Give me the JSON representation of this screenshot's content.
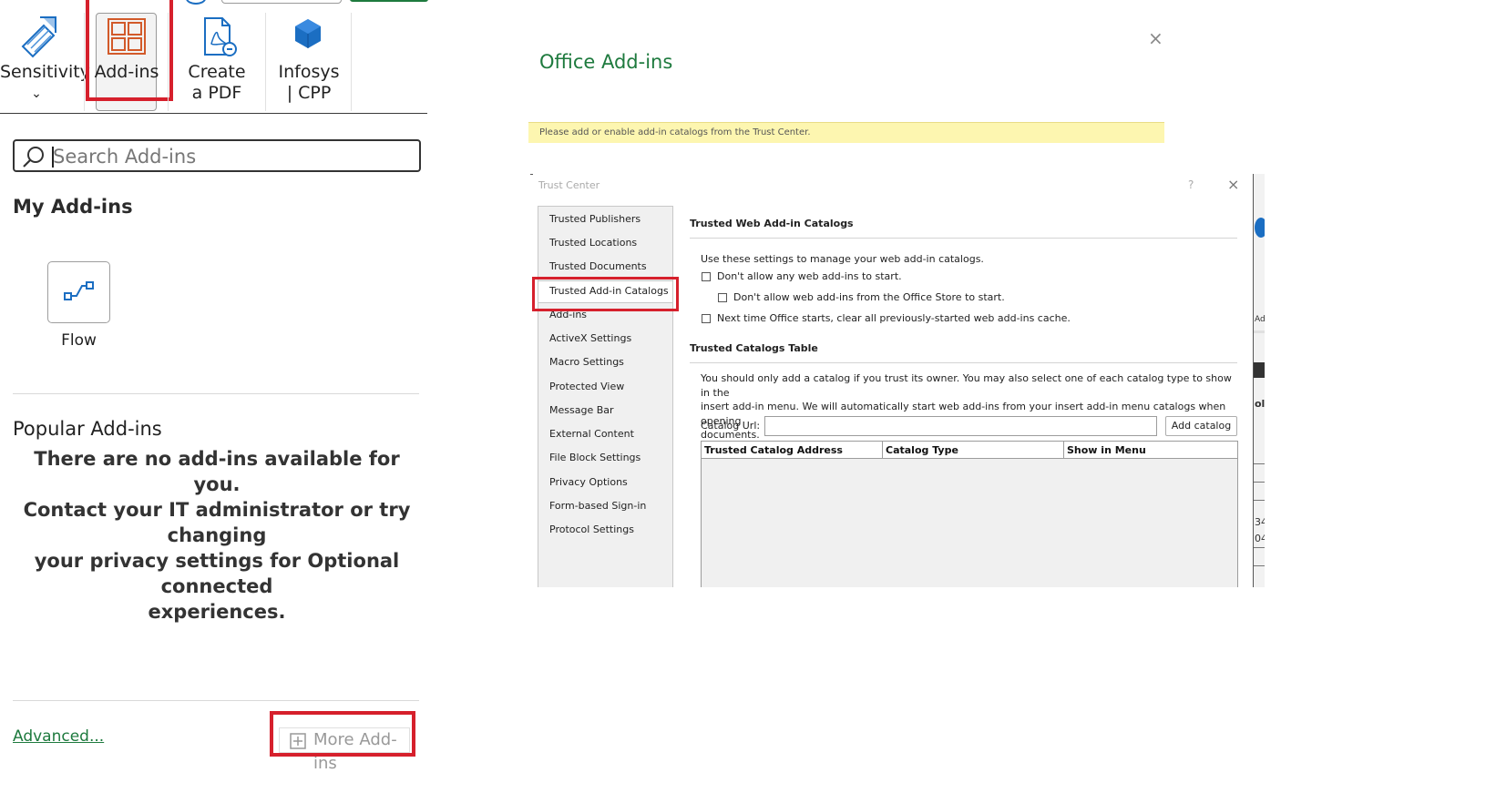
{
  "ribbon": {
    "sensitivity": {
      "label": "Sensitivity",
      "chevron": "⌄",
      "icon": "sensitivity-icon"
    },
    "addins": {
      "label": "Add-ins",
      "icon": "addins-grid-icon"
    },
    "create_pdf": {
      "line1": "Create",
      "line2": "a PDF",
      "icon": "pdf-icon"
    },
    "infosys": {
      "line1": "Infosys",
      "line2": "| CPP",
      "icon": "cube-icon"
    }
  },
  "search": {
    "placeholder": "Search Add-ins"
  },
  "my_addins": {
    "heading": "My Add-ins",
    "items": [
      {
        "label": "Flow",
        "icon": "flow-icon"
      }
    ]
  },
  "popular": {
    "heading": "Popular Add-ins",
    "message_lines": [
      "There are no add-ins available for you.",
      "Contact your IT administrator or try changing",
      "your privacy settings for Optional connected",
      "experiences."
    ]
  },
  "footer": {
    "advanced_link": "Advanced...",
    "more_addins": "More Add-ins"
  },
  "office_dialog": {
    "title": "Office Add-ins",
    "close": "×",
    "warning": "Please add or enable add-in catalogs from the Trust Center."
  },
  "trust_center": {
    "title": "Trust Center",
    "help": "?",
    "close": "×",
    "nav": [
      "Trusted Publishers",
      "Trusted Locations",
      "Trusted Documents",
      "Trusted Add-in Catalogs",
      "Add-ins",
      "ActiveX Settings",
      "Macro Settings",
      "Protected View",
      "Message Bar",
      "External Content",
      "File Block Settings",
      "Privacy Options",
      "Form-based Sign-in",
      "Protocol Settings"
    ],
    "selected_nav": "Trusted Add-in Catalogs",
    "web_catalogs": {
      "heading": "Trusted Web Add-in Catalogs",
      "intro": "Use these settings to manage your web add-in catalogs.",
      "opt1": "Don't allow any web add-ins to start.",
      "opt2": "Don't allow web add-ins from the Office Store to start.",
      "opt3": "Next time Office starts, clear all previously-started web add-ins cache."
    },
    "catalogs_table": {
      "heading": "Trusted Catalogs Table",
      "desc_lines": [
        "You should only add a catalog if you trust its owner. You may also select one of each catalog type to show in the",
        "insert add-in menu. We will automatically start web add-ins from your insert add-in menu catalogs when opening",
        "documents."
      ],
      "url_label": "Catalog Url:",
      "url_value": "",
      "add_button": "Add catalog",
      "columns": [
        "Trusted Catalog Address",
        "Catalog Type",
        "Show in Menu"
      ],
      "rows": []
    },
    "behind_window_fragments": [
      "Ad",
      "ol",
      "34",
      "04"
    ]
  },
  "colors": {
    "accent_green": "#1e7a3e",
    "highlight_red": "#d6202c",
    "warning_yellow": "#fdf6b0"
  }
}
